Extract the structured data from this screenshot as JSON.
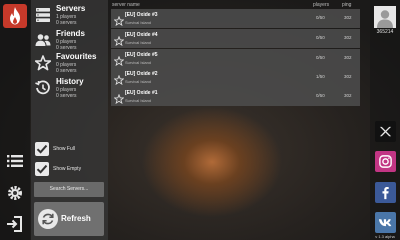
{
  "left_rail": {
    "app_icon": "fire-icon",
    "buttons": [
      "list-icon",
      "gear-icon",
      "exit-icon"
    ]
  },
  "sidebar": {
    "items": [
      {
        "title": "Servers",
        "line1": "1 players",
        "line2": "0 servers",
        "icon": "server-icon"
      },
      {
        "title": "Friends",
        "line1": "0 players",
        "line2": "0 servers",
        "icon": "friends-icon"
      },
      {
        "title": "Favourites",
        "line1": "0 players",
        "line2": "0 servers",
        "icon": "star-icon"
      },
      {
        "title": "History",
        "line1": "0 players",
        "line2": "0 servers",
        "icon": "history-icon"
      }
    ],
    "show_full": {
      "label": "Show Full",
      "checked": true
    },
    "show_empty": {
      "label": "Show Empty",
      "checked": true
    },
    "search_label": "Search Servers...",
    "refresh_label": "Refresh"
  },
  "server_list": {
    "columns": {
      "name": "server name",
      "players": "players",
      "ping": "ping"
    },
    "rows": [
      {
        "name": "[EU] Oxide #3",
        "map": "Survival Island",
        "players": "0/50",
        "ping": "302"
      },
      {
        "name": "[EU] Oxide #4",
        "map": "Survival Island",
        "players": "0/50",
        "ping": "302"
      },
      {
        "name": "[EU] Oxide #5",
        "map": "Survival Island",
        "players": "0/50",
        "ping": "302"
      },
      {
        "name": "[EU] Oxide #2",
        "map": "Survival Island",
        "players": "1/50",
        "ping": "302"
      },
      {
        "name": "[EU] Oxide #1",
        "map": "Survival Island",
        "players": "0/50",
        "ping": "302"
      }
    ]
  },
  "right_rail": {
    "user_id": "365214",
    "socials": [
      {
        "name": "twitter-icon",
        "color": "#111111"
      },
      {
        "name": "instagram-icon",
        "color": "#c13584"
      },
      {
        "name": "facebook-icon",
        "color": "#3b5998"
      },
      {
        "name": "vk-icon",
        "color": "#4a76a8"
      }
    ],
    "version": "v 1.3 alpha"
  },
  "colors": {
    "accent_red": "#c6392a",
    "row_bg": "#4e4e4e"
  }
}
